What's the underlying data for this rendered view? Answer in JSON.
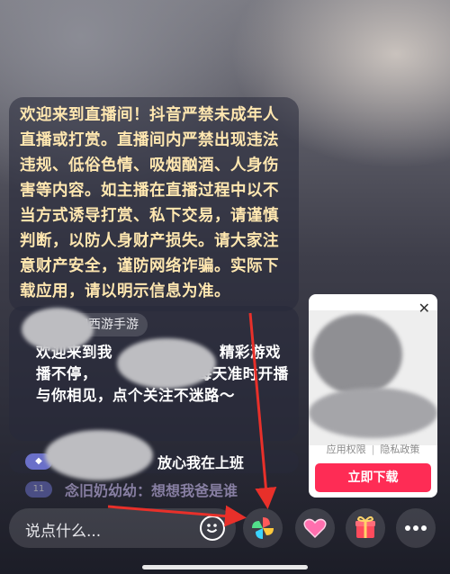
{
  "notice": {
    "text": "欢迎来到直播间！抖音严禁未成年人直播或打赏。直播间内严禁出现违法违规、低俗色情、吸烟酗酒、人身伤害等内容。如主播在直播过程中以不当方式诱导打赏、私下交易，请谨慎判断，以防人身财产损失。请大家注意财产安全，谨防网络诈骗。实际下载应用，请以明示信息为准。"
  },
  "streamer_card": {
    "name": "梦幻西游手游",
    "message": "欢迎来到我　　　　　　　精彩游戏播不停，　　　　　有，每天准时开播与你相见，点个关注不迷路～"
  },
  "chat": [
    {
      "level": "",
      "text": "放心我在上班"
    },
    {
      "level": "11",
      "text": "念旧奶幼幼：想想我爸是谁"
    }
  ],
  "ad": {
    "close": "✕",
    "permissions": "应用权限",
    "privacy": "隐私政策",
    "download": "立即下载"
  },
  "bottom_bar": {
    "placeholder": "说点什么...",
    "icons": [
      "smiley-icon",
      "pinwheel-icon",
      "heart-icon",
      "gift-icon",
      "more-icon"
    ]
  },
  "colors": {
    "accent": "#fe2c55",
    "notice_text": "#ffe7b0",
    "arrow": "#e8302a"
  }
}
